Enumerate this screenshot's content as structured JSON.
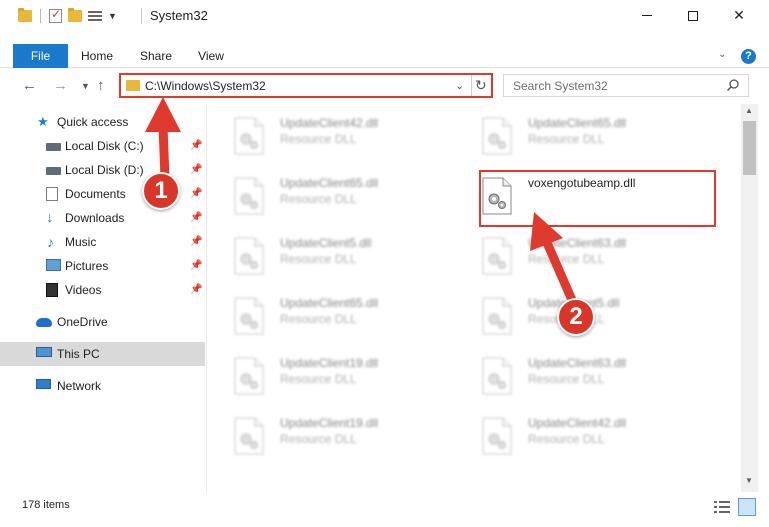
{
  "window": {
    "title": "System32"
  },
  "ribbon": {
    "tabs": [
      {
        "label": "File"
      },
      {
        "label": "Home"
      },
      {
        "label": "Share"
      },
      {
        "label": "View"
      }
    ]
  },
  "navigation": {
    "address_path": "C:\\Windows\\System32",
    "search_placeholder": "Search System32"
  },
  "sidebar": {
    "items": [
      {
        "label": "Quick access",
        "icon": "star-icon",
        "pinned": false
      },
      {
        "label": "Local Disk (C:)",
        "icon": "local-disk-icon",
        "pinned": true
      },
      {
        "label": "Local Disk (D:)",
        "icon": "local-disk-icon",
        "pinned": true
      },
      {
        "label": "Documents",
        "icon": "documents-icon",
        "pinned": true
      },
      {
        "label": "Downloads",
        "icon": "downloads-icon",
        "pinned": true
      },
      {
        "label": "Music",
        "icon": "music-icon",
        "pinned": true
      },
      {
        "label": "Pictures",
        "icon": "pictures-icon",
        "pinned": true
      },
      {
        "label": "Videos",
        "icon": "videos-icon",
        "pinned": true
      },
      {
        "label": "OneDrive",
        "icon": "onedrive-icon",
        "pinned": false
      },
      {
        "label": "This PC",
        "icon": "this-pc-icon",
        "pinned": false,
        "selected": true
      },
      {
        "label": "Network",
        "icon": "network-icon",
        "pinned": false
      }
    ]
  },
  "files": {
    "left_column": [
      {
        "name": "UpdateClient42.dll",
        "type": "Resource DLL"
      },
      {
        "name": "UpdateClient65.dll",
        "type": "Resource DLL"
      },
      {
        "name": "UpdateClient5.dll",
        "type": "Resource DLL"
      },
      {
        "name": "UpdateClient65.dll",
        "type": "Resource DLL"
      },
      {
        "name": "UpdateClient19.dll",
        "type": "Resource DLL"
      },
      {
        "name": "UpdateClient19.dll",
        "type": "Resource DLL"
      }
    ],
    "right_column": [
      {
        "name": "UpdateClient65.dll",
        "type": "Resource DLL"
      },
      {
        "name": "voxengotubeamp.dll",
        "type": "",
        "highlighted": true
      },
      {
        "name": "UpdateClient63.dll",
        "type": "Resource DLL"
      },
      {
        "name": "UpdateClient5.dll",
        "type": "Resource DLL"
      },
      {
        "name": "UpdateClient63.dll",
        "type": "Resource DLL"
      },
      {
        "name": "UpdateClient42.dll",
        "type": "Resource DLL"
      }
    ]
  },
  "status": {
    "item_count": "178 items"
  },
  "annotations": {
    "step1": "1",
    "step2": "2",
    "accent_color": "#d93629"
  }
}
